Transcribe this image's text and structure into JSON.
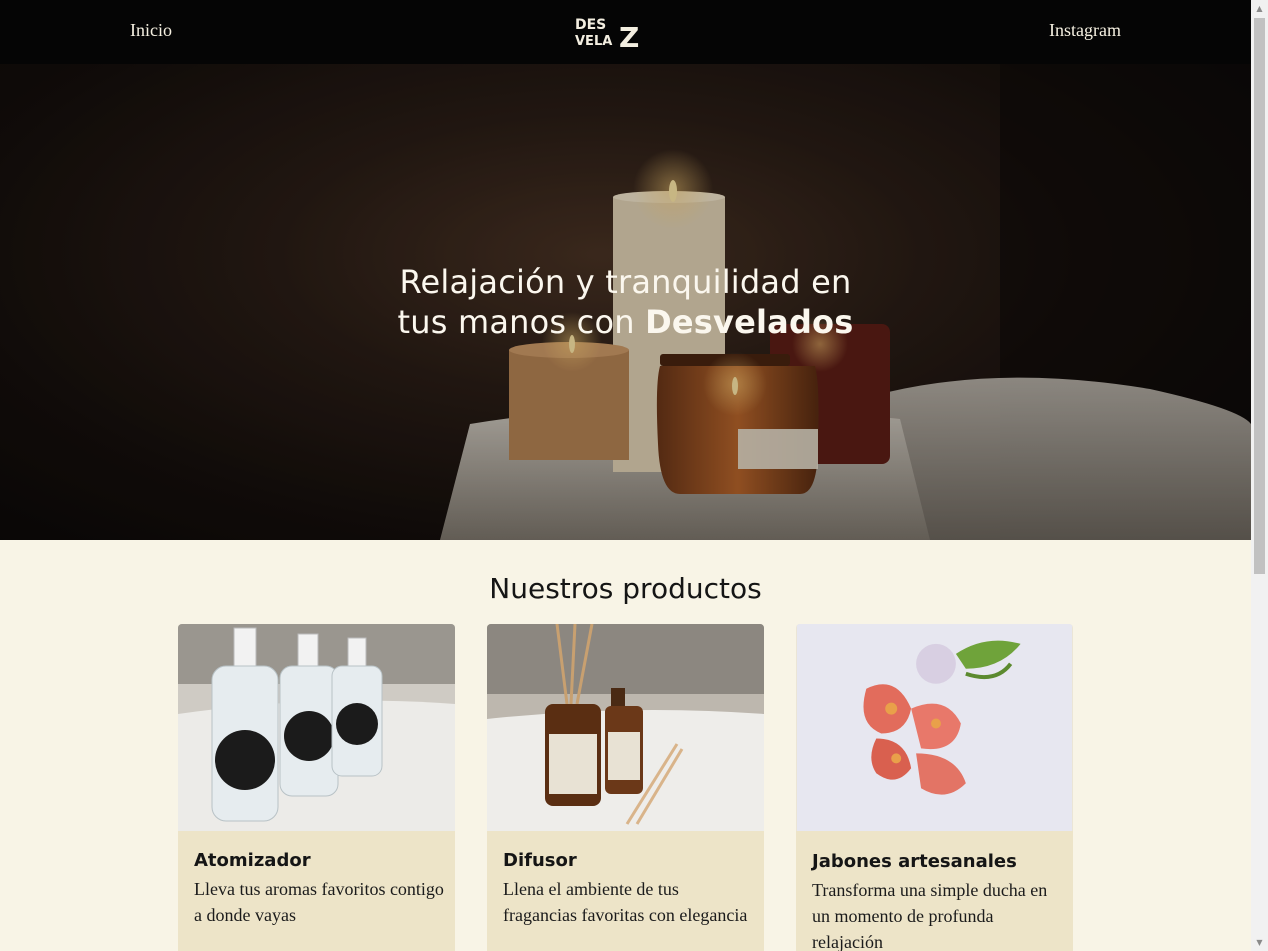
{
  "nav": {
    "home_label": "Inicio",
    "instagram_label": "Instagram",
    "logo_text_top": "DES",
    "logo_text_bottom": "VELA",
    "logo_text_z": "Z"
  },
  "hero": {
    "title_line1": "Relajación y tranquilidad en",
    "title_line2_prefix": "tus manos con ",
    "title_brand": "Desvelados"
  },
  "products": {
    "heading": "Nuestros productos",
    "items": [
      {
        "name": "Atomizador",
        "description": "Lleva tus aromas favoritos contigo a donde vayas"
      },
      {
        "name": "Difusor",
        "description": "Llena el ambiente de tus fragancias favoritas con elegancia"
      },
      {
        "name": "Jabones artesanales",
        "description": "Transforma una simple ducha en un momento de profunda relajación"
      }
    ]
  },
  "colors": {
    "nav_bg": "#050505",
    "page_bg": "#f8f4e6",
    "card_bg": "#ede4c8"
  },
  "icons": {
    "scroll_up": "▲",
    "scroll_down": "▼"
  }
}
